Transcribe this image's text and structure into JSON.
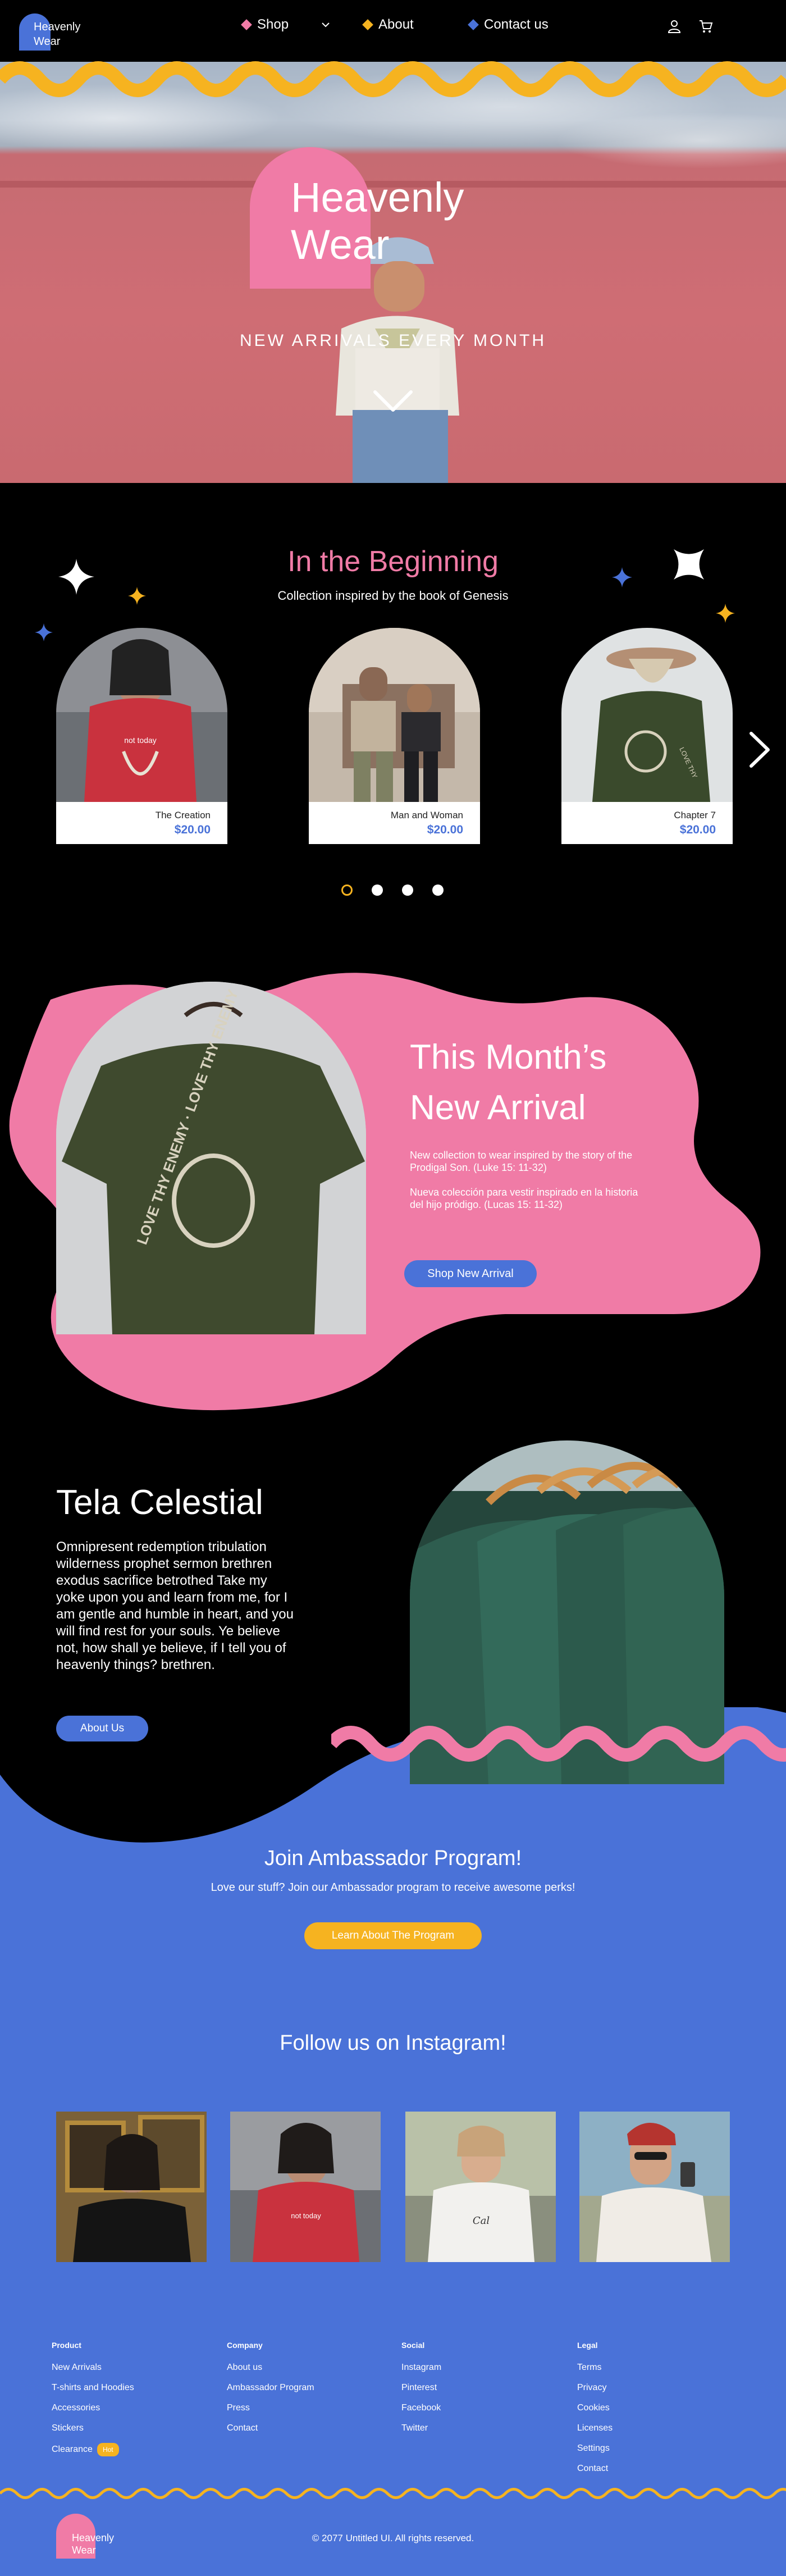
{
  "brand": {
    "name_line1": "Heavenly",
    "name_line2": "Wear"
  },
  "nav": {
    "items": [
      {
        "label": "Shop",
        "color": "#f07ba6"
      },
      {
        "label": "About",
        "color": "#f6b320"
      },
      {
        "label": "Contact us",
        "color": "#4a72d8"
      }
    ]
  },
  "hero": {
    "title_line1": "Heavenly",
    "title_line2": "Wear",
    "subtitle": "NEW ARRIVALS EVERY MONTH"
  },
  "beginning": {
    "title": "In the Beginning",
    "subtitle": "Collection inspired by the book of Genesis",
    "products": [
      {
        "name": "The Creation",
        "price": "$20.00"
      },
      {
        "name": "Man and Woman",
        "price": "$20.00"
      },
      {
        "name": "Chapter 7",
        "price": "$20.00"
      }
    ]
  },
  "arrival": {
    "title_line1": "This Month’s",
    "title_line2": "New Arrival",
    "text_en": "New collection to wear inspired by the story of the Prodigal Son. (Luke 15: 11-32)",
    "text_es": "Nueva colección para vestir inspirado en la historia del hijo pródigo. (Lucas 15: 11-32)",
    "button": "Shop New Arrival",
    "shirt_print": "LOVE THY ENEMY · LOVE THY ENEMY"
  },
  "tela": {
    "title": "Tela Celestial",
    "body": "Omnipresent redemption tribulation wilderness prophet sermon brethren exodus sacrifice betrothed Take my yoke upon you and learn from me, for I am gentle and humble in heart, and you will find rest for your souls. Ye believe not, how shall ye believe, if I tell you of heavenly things? brethren.",
    "button": "About Us"
  },
  "ambassador": {
    "title": "Join Ambassador Program!",
    "text": "Love our stuff? Join our Ambassador program to receive awesome perks!",
    "button": "Learn About The Program"
  },
  "instagram": {
    "title": "Follow us on Instagram!"
  },
  "footer": {
    "columns": [
      {
        "heading": "Product",
        "links": [
          "New Arrivals",
          "T-shirts and Hoodies",
          "Accessories",
          "Stickers",
          "Clearance"
        ]
      },
      {
        "heading": "Company",
        "links": [
          "About us",
          "Ambassador Program",
          "Press",
          "Contact"
        ]
      },
      {
        "heading": "Social",
        "links": [
          "Instagram",
          "Pinterest",
          "Facebook",
          "Twitter"
        ]
      },
      {
        "heading": "Legal",
        "links": [
          "Terms",
          "Privacy",
          "Cookies",
          "Licenses",
          "Settings",
          "Contact"
        ]
      }
    ],
    "clearance_badge": "Hot",
    "copyright": "© 2077 Untitled UI. All rights reserved."
  },
  "colors": {
    "pink": "#f07ba6",
    "blue": "#4a72d8",
    "yellow": "#f6b320",
    "black": "#000000"
  }
}
